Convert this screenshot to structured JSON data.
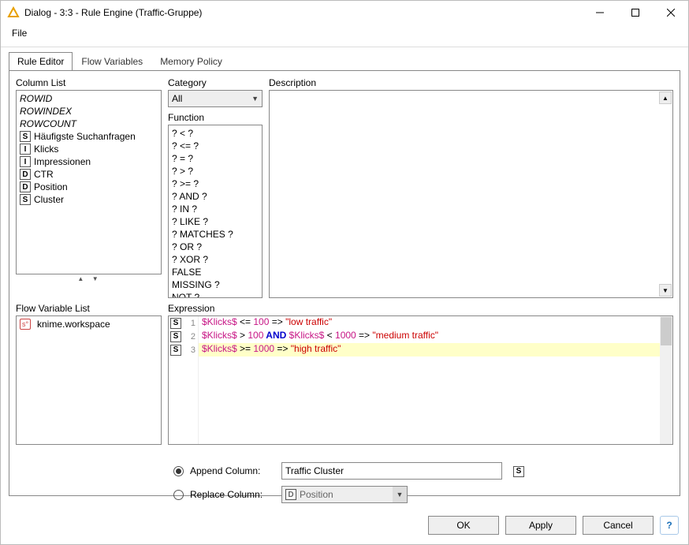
{
  "window": {
    "title": "Dialog - 3:3 - Rule Engine (Traffic-Gruppe)"
  },
  "menu": {
    "file": "File"
  },
  "tabs": {
    "rule_editor": "Rule Editor",
    "flow_variables": "Flow Variables",
    "memory_policy": "Memory Policy"
  },
  "labels": {
    "column_list": "Column List",
    "category": "Category",
    "function": "Function",
    "description": "Description",
    "flow_var_list": "Flow Variable List",
    "expression": "Expression",
    "append_column": "Append Column:",
    "replace_column": "Replace Column:"
  },
  "category_select": "All",
  "columns": {
    "rowid": "ROWID",
    "rowindex": "ROWINDEX",
    "rowcount": "ROWCOUNT",
    "list": [
      {
        "type": "S",
        "name": "Häufigste Suchanfragen"
      },
      {
        "type": "I",
        "name": "Klicks"
      },
      {
        "type": "I",
        "name": "Impressionen"
      },
      {
        "type": "D",
        "name": "CTR"
      },
      {
        "type": "D",
        "name": "Position"
      },
      {
        "type": "S",
        "name": "Cluster"
      }
    ]
  },
  "functions": [
    "? < ?",
    "? <= ?",
    "? = ?",
    "? > ?",
    "? >= ?",
    "? AND ?",
    "? IN ?",
    "? LIKE ?",
    "? MATCHES ?",
    "? OR ?",
    "? XOR ?",
    "FALSE",
    "MISSING ?",
    "NOT ?"
  ],
  "flow_vars": [
    {
      "icon": "s",
      "name": "knime.workspace"
    }
  ],
  "expression": {
    "line1": {
      "var": "$Klicks$",
      "rest1": " <= ",
      "num1": "100",
      "arrow": " => ",
      "str": "\"low traffic\""
    },
    "line2": {
      "var": "$Klicks$",
      "rest1": " > ",
      "num1": "100",
      "kw": " AND ",
      "var2": "$Klicks$",
      "rest2": " < ",
      "num2": "1000",
      "arrow": " => ",
      "str": "\"medium traffic\""
    },
    "line3": {
      "var": "$Klicks$",
      "rest1": " >= ",
      "num1": "1000",
      "arrow": " => ",
      "str": "\"high traffic\""
    }
  },
  "append_value": "Traffic Cluster",
  "replace_value": "Position",
  "replace_type": "D",
  "append_type": "S",
  "buttons": {
    "ok": "OK",
    "apply": "Apply",
    "cancel": "Cancel"
  }
}
